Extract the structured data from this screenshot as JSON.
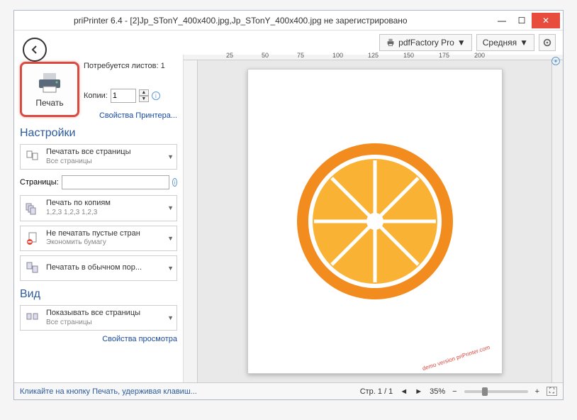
{
  "title": "priPrinter 6.4 - [2]Jp_STonY_400x400.jpg,Jp_STonY_400x400.jpg не зарегистрировано",
  "printer_dropdown": {
    "name": "pdfFactory Pro",
    "quality": "Средняя"
  },
  "sheets_label": "Потребуется листов: 1",
  "print_label": "Печать",
  "copies_label": "Копии:",
  "copies_value": "1",
  "printer_props": "Свойства Принтера...",
  "settings_title": "Настройки",
  "opt_allpages": {
    "t": "Печатать все страницы",
    "s": "Все страницы"
  },
  "pages_label": "Страницы:",
  "opt_copies": {
    "t": "Печать по копиям",
    "s": "1,2,3  1,2,3  1,2,3"
  },
  "opt_skipblank": {
    "t": "Не печатать пустые стран",
    "s": "Экономить бумагу"
  },
  "opt_normal": {
    "t": "Печатать в обычном пор..."
  },
  "view_title": "Вид",
  "opt_showall": {
    "t": "Показывать все страницы",
    "s": "Все страницы"
  },
  "view_props": "Свойства просмотра",
  "ruler_ticks": [
    "25",
    "50",
    "75",
    "100",
    "125",
    "150",
    "175",
    "200"
  ],
  "status_hint": "Кликайте на кнопку Печать, удерживая клавиш...",
  "status_page": "Стр. 1 / 1",
  "zoom": "35%",
  "watermark": "demo version\npriPrinter.com"
}
